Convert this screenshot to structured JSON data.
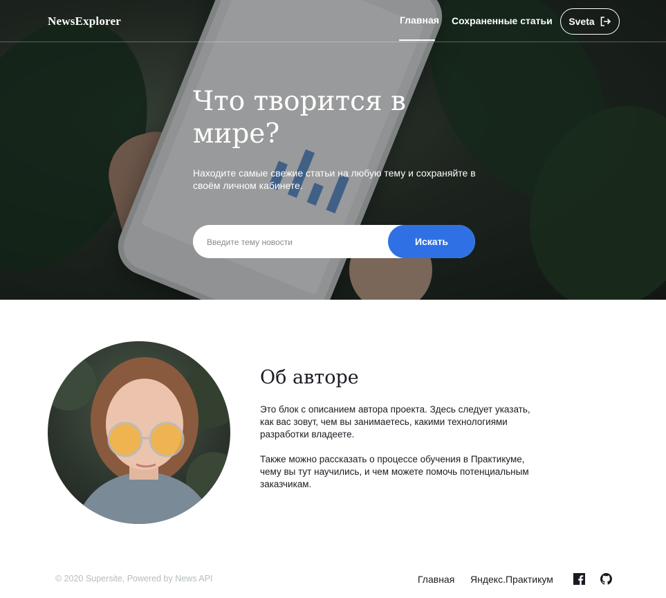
{
  "header": {
    "logo": "NewsExplorer",
    "nav": {
      "main": "Главная",
      "saved": "Сохраненные статьи"
    },
    "user": {
      "name": "Sveta",
      "icon": "logout-icon"
    }
  },
  "hero": {
    "title": "Что творится в мире?",
    "subtitle": "Находите самые свежие статьи на любую тему и сохраняйте в своём личном кабинете.",
    "search": {
      "placeholder": "Введите тему новости",
      "value": "",
      "button": "Искать"
    }
  },
  "about": {
    "title": "Об авторе",
    "paragraph1": "Это блок с описанием автора проекта. Здесь следует указать, как вас зовут, чем вы занимаетесь, какими технологиями разработки владеете.",
    "paragraph2": "Также можно рассказать о процессе обучения в Практикуме, чему вы тут научились, и чем можете помочь потенциальным заказчикам."
  },
  "footer": {
    "copyright": "© 2020 Supersite, Powered by News API",
    "links": {
      "main": "Главная",
      "yandex": "Яндекс.Практикум"
    },
    "icons": [
      "facebook-icon",
      "github-icon"
    ]
  },
  "colors": {
    "accent": "#2F71E5",
    "text": "#1A1B22",
    "muted": "#B6BCBF"
  }
}
